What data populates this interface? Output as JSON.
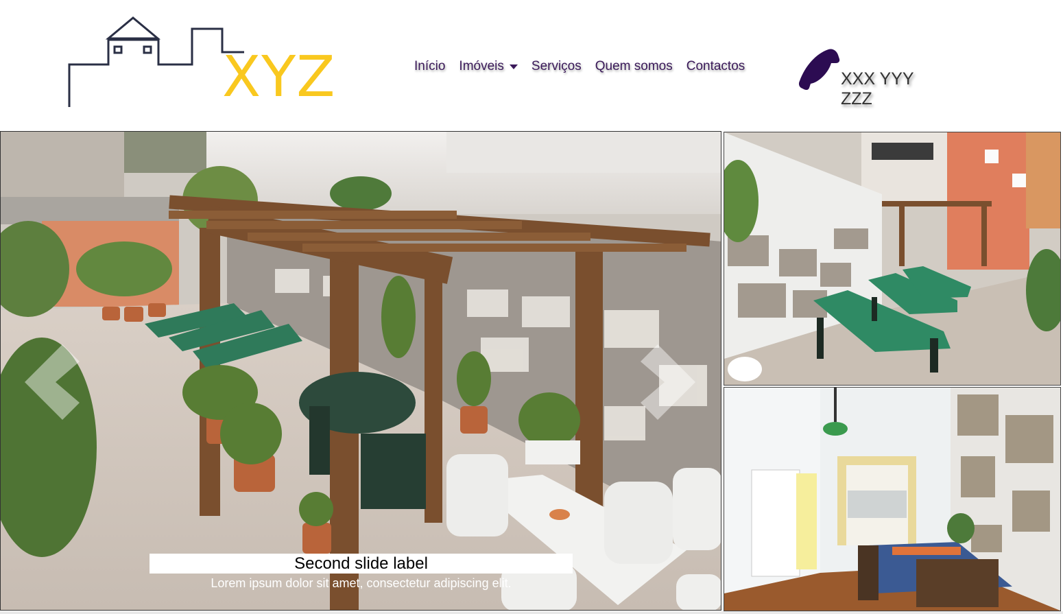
{
  "brand": {
    "logo_text": "XYZ"
  },
  "nav": {
    "items": [
      {
        "label": "Início"
      },
      {
        "label": "Imóveis",
        "dropdown": true
      },
      {
        "label": "Serviços"
      },
      {
        "label": "Quem somos"
      },
      {
        "label": "Contactos"
      }
    ]
  },
  "contact": {
    "phone_icon": "phone-icon",
    "phone": "XXX YYY ZZZ"
  },
  "carousel": {
    "caption_title": "Second slide label",
    "caption_text": "Lorem ipsum dolor sit amet, consectetur adipiscing elit.",
    "prev_icon": "chevron-left-icon",
    "next_icon": "chevron-right-icon"
  },
  "colors": {
    "accent_yellow": "#f9c81f",
    "nav_purple": "#3b1a5a",
    "logo_outline": "#2a2f45"
  }
}
